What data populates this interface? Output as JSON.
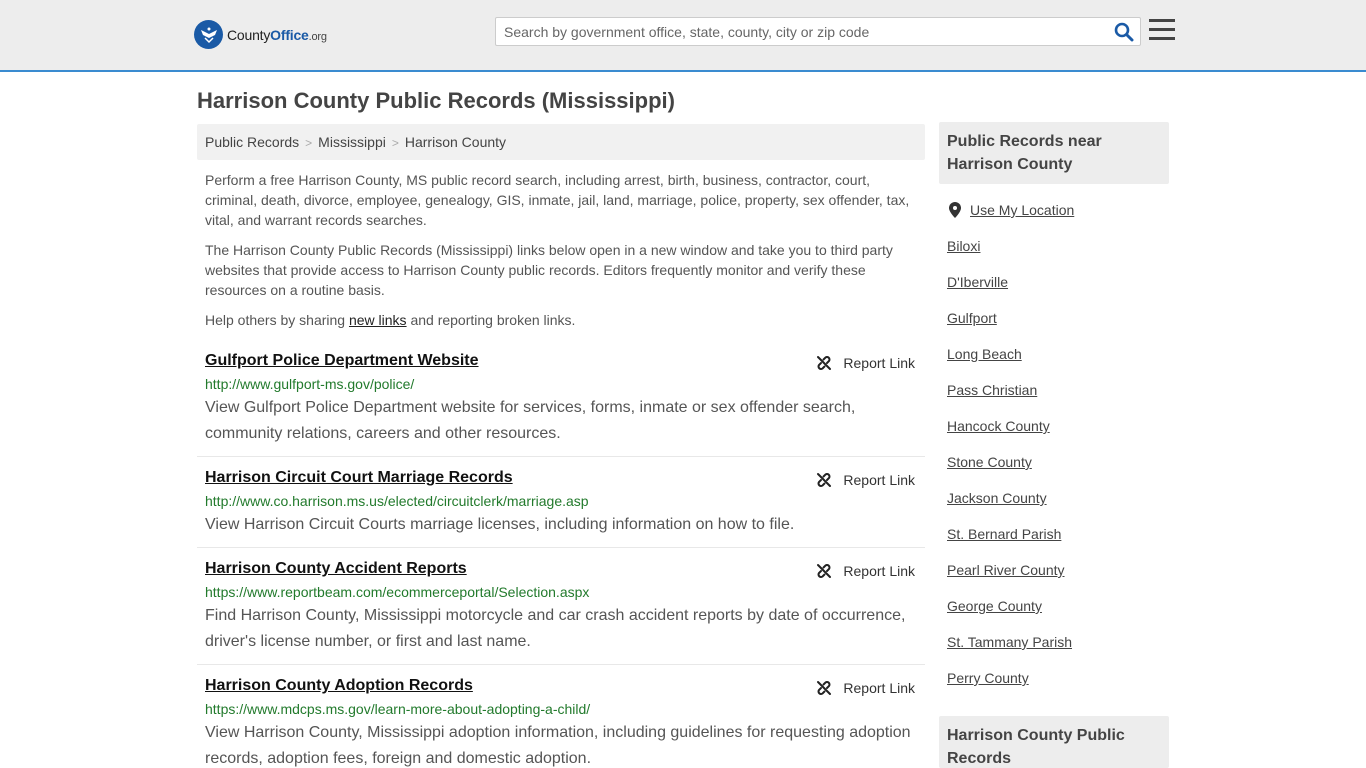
{
  "header": {
    "logo_county": "County",
    "logo_office": "Office",
    "logo_tld": ".org",
    "search_placeholder": "Search by government office, state, county, city or zip code"
  },
  "page_title": "Harrison County Public Records (Mississippi)",
  "breadcrumb": [
    "Public Records",
    "Mississippi",
    "Harrison County"
  ],
  "intro": {
    "p1": "Perform a free Harrison County, MS public record search, including arrest, birth, business, contractor, court, criminal, death, divorce, employee, genealogy, GIS, inmate, jail, land, marriage, police, property, sex offender, tax, vital, and warrant records searches.",
    "p2": "The Harrison County Public Records (Mississippi) links below open in a new window and take you to third party websites that provide access to Harrison County public records. Editors frequently monitor and verify these resources on a routine basis.",
    "p3_before": "Help others by sharing ",
    "p3_link": "new links",
    "p3_after": " and reporting broken links."
  },
  "report_label": "Report Link",
  "records": [
    {
      "title": "Gulfport Police Department Website",
      "url": "http://www.gulfport-ms.gov/police/",
      "desc": "View Gulfport Police Department website for services, forms, inmate or sex offender search, community relations, careers and other resources."
    },
    {
      "title": "Harrison Circuit Court Marriage Records",
      "url": "http://www.co.harrison.ms.us/elected/circuitclerk/marriage.asp",
      "desc": "View Harrison Circuit Courts marriage licenses, including information on how to file."
    },
    {
      "title": "Harrison County Accident Reports",
      "url": "https://www.reportbeam.com/ecommerceportal/Selection.aspx",
      "desc": "Find Harrison County, Mississippi motorcycle and car crash accident reports by date of occurrence, driver's license number, or first and last name."
    },
    {
      "title": "Harrison County Adoption Records",
      "url": "https://www.mdcps.ms.gov/learn-more-about-adopting-a-child/",
      "desc": "View Harrison County, Mississippi adoption information, including guidelines for requesting adoption records, adoption fees, foreign and domestic adoption."
    }
  ],
  "sidebar": {
    "near_heading": "Public Records near Harrison County",
    "use_location": "Use My Location",
    "links": [
      "Biloxi",
      "D'Iberville",
      "Gulfport",
      "Long Beach",
      "Pass Christian",
      "Hancock County",
      "Stone County",
      "Jackson County",
      "St. Bernard Parish",
      "Pearl River County",
      "George County",
      "St. Tammany Parish",
      "Perry County"
    ],
    "second_heading": "Harrison County Public Records"
  }
}
